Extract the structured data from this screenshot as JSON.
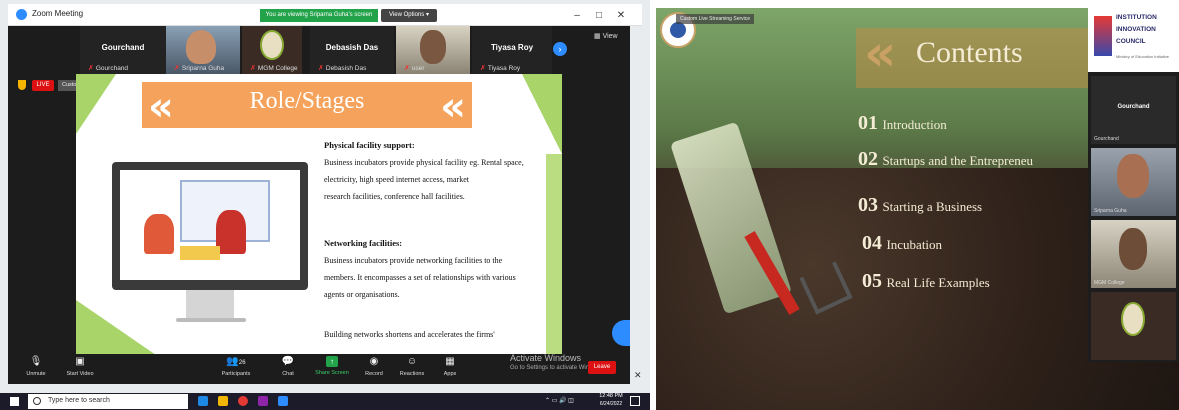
{
  "left": {
    "app_title": "Zoom Meeting",
    "viewing_banner": "You are viewing Sriparna Guha's screen",
    "view_options": "View Options",
    "view_label": "View",
    "participants": [
      {
        "name": "Gourchand",
        "label": "Gourchand",
        "has_video": false
      },
      {
        "name": "",
        "label": "Sriparna Guha",
        "has_video": true
      },
      {
        "name": "",
        "label": "MGM College",
        "has_video": true
      },
      {
        "name": "Debasish Das",
        "label": "Debasish Das",
        "has_video": false
      },
      {
        "name": "",
        "label": "user",
        "has_video": true
      },
      {
        "name": "Tiyasa Roy",
        "label": "Tiyasa Roy",
        "has_video": false
      }
    ],
    "live_badge": "LIVE",
    "stream_label": "Custom Live Streaming Service",
    "slide": {
      "title": "Role/Stages",
      "sections": [
        {
          "heading": "Physical facility support:",
          "lines": [
            "Business incubators provide physical facility eg. Rental space,",
            "electricity, high speed internet access, market",
            "research facilities, conference hall facilities."
          ]
        },
        {
          "heading": "Networking facilities:",
          "lines": [
            "Business incubators provide networking facilities to the",
            "members. It encompasses a set of relationships with various",
            "agents or organisations."
          ]
        }
      ],
      "footer_line": "Building networks shortens and accelerates the firms'"
    },
    "toolbar": [
      {
        "label": "Unmute",
        "icon": "mic-icon"
      },
      {
        "label": "Start Video",
        "icon": "video-icon"
      },
      {
        "label": "Participants",
        "icon": "participants-icon",
        "count": "26"
      },
      {
        "label": "Chat",
        "icon": "chat-icon"
      },
      {
        "label": "Share Screen",
        "icon": "share-screen-icon"
      },
      {
        "label": "Record",
        "icon": "record-icon"
      },
      {
        "label": "Reactions",
        "icon": "reactions-icon"
      },
      {
        "label": "Apps",
        "icon": "apps-icon"
      }
    ],
    "leave": "Leave",
    "activate_title": "Activate Windows",
    "activate_sub": "Go to Settings to activate Windows.",
    "taskbar": {
      "search_placeholder": "Type here to search",
      "time": "12:48 PM",
      "date": "6/24/2022"
    }
  },
  "right": {
    "stream_label": "Custom Live Streaming Service",
    "title": "Contents",
    "items": [
      {
        "num": "01",
        "text": "Introduction"
      },
      {
        "num": "02",
        "text": "Startups and the Entrepreneu"
      },
      {
        "num": "03",
        "text": "Starting a Business"
      },
      {
        "num": "04",
        "text": "Incubation"
      },
      {
        "num": "05",
        "text": "Real Life Examples"
      }
    ],
    "iic": {
      "line1": "INSTITUTION",
      "line2": "INNOVATION",
      "line3": "COUNCIL",
      "sub": "Ministry of Education Initiative"
    },
    "gallery": [
      {
        "name": "Gourchand",
        "label": "Gourchand"
      },
      {
        "name": "",
        "label": "Sriparna Guha"
      },
      {
        "name": "",
        "label": "MGM College"
      },
      {
        "name": "",
        "label": ""
      }
    ]
  }
}
